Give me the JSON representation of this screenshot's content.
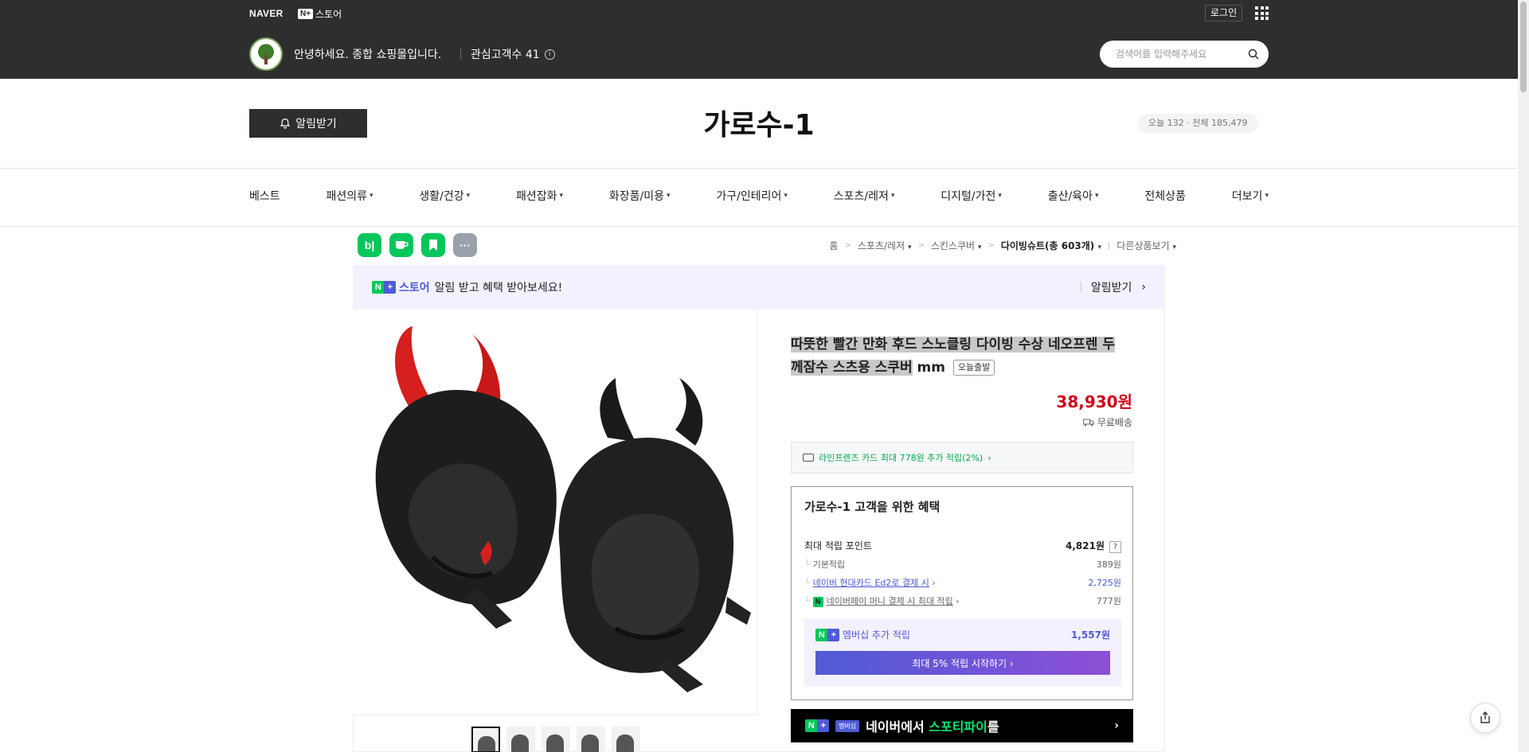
{
  "topbar": {
    "naver": "NAVER",
    "nplus_box": "N+",
    "nplus_store": "스토어",
    "login": "로그인",
    "greeting": "안녕하세요. 종합 쇼핑몰입니다.",
    "interest": "관심고객수 41",
    "search_placeholder": "검색어를 입력해주세요"
  },
  "header": {
    "alarm_label": "알림받기",
    "store_title": "가로수-1",
    "visits": "오늘 132 · 전체 185,479"
  },
  "nav": {
    "items": [
      "베스트",
      "패션의류",
      "생활/건강",
      "패션잡화",
      "화장품/미용",
      "가구/인테리어",
      "스포츠/레저",
      "디지털/가전",
      "출산/육아",
      "전체상품",
      "더보기"
    ]
  },
  "share": {
    "blog": "b|",
    "more": "···"
  },
  "breadcrumb": {
    "home": "홈",
    "cat1": "스포츠/레저",
    "cat2": "스킨스쿠버",
    "cat3": "다이빙슈트(총 603개)",
    "other": "다른상품보기"
  },
  "promo": {
    "store": "스토어",
    "text": "알림 받고 혜택 받아보세요!",
    "action": "알림받기"
  },
  "product": {
    "title_highlight": "따뜻한 빨간 만화 후드 스노클링 다이빙 수상 네오프렌 두께잠수 스츠용 스쿠버",
    "title_rest": " mm",
    "badge": "오늘출발",
    "price": "38,930원",
    "shipping": "무료배송",
    "card_benefit": "라인프렌즈 카드 최대 778원 추가 적립(2%)"
  },
  "benefit": {
    "title": "가로수-1 고객을 위한 혜택",
    "max_label": "최대 적립 포인트",
    "max_value": "4,821원",
    "q": "?",
    "basic_label": "기본적립",
    "basic_value": "389원",
    "card_label": "네이버 현대카드 Ed2로 결제 시",
    "card_value": "2,725원",
    "pay_label": "네이버페이 머니 결제 시 최대 적립",
    "pay_value": "777원",
    "member_label": "멤버십 추가 적립",
    "member_value": "1,557원",
    "member_btn": "최대 5% 적립 시작하기"
  },
  "spoti": {
    "tag": "멤버십",
    "text1": "네이버에서 ",
    "text2": "스포티파이",
    "text3": "를"
  }
}
